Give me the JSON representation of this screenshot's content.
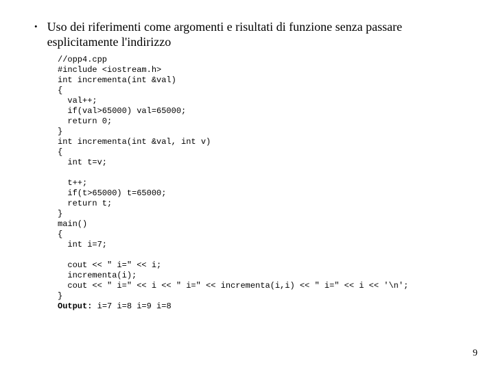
{
  "bullet": {
    "marker": "•",
    "text": "Uso dei riferimenti come argomenti e risultati di funzione senza passare esplicitamente l'indirizzo"
  },
  "code": "//opp4.cpp\n#include <iostream.h>\nint incrementa(int &val)\n{\n  val++;\n  if(val>65000) val=65000;\n  return 0;\n}\nint incrementa(int &val, int v)\n{\n  int t=v;\n\n  t++;\n  if(t>65000) t=65000;\n  return t;\n}\nmain()\n{\n  int i=7;\n\n  cout << \" i=\" << i;\n  incrementa(i);\n  cout << \" i=\" << i << \" i=\" << incrementa(i,i) << \" i=\" << i << '\\n';\n}",
  "output": {
    "label": "Output:",
    "text": " i=7 i=8 i=9 i=8"
  },
  "pageNumber": "9"
}
